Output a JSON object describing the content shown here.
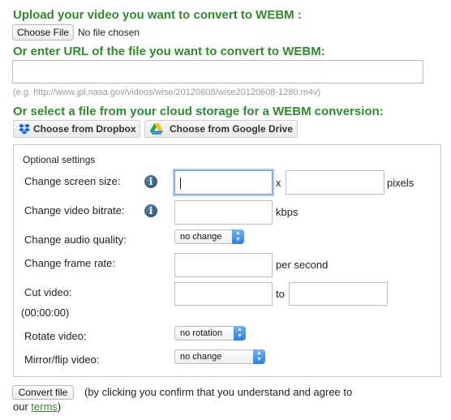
{
  "upload": {
    "heading": "Upload your video you want to convert to WEBM :",
    "choose_file_label": "Choose File",
    "file_status": "No file chosen"
  },
  "url": {
    "heading": "Or enter URL of the file you want to convert to WEBM:",
    "value": "",
    "example": "(e.g. http://www.jpl.nasa.gov/videos/wise/20120608/wise20120608-1280.m4v)"
  },
  "cloud": {
    "heading": "Or select a file from your cloud storage for a WEBM conversion:",
    "dropbox_label": "Choose from Dropbox",
    "gdrive_label": "Choose from Google Drive"
  },
  "settings": {
    "title": "Optional settings",
    "screen_size_label": "Change screen size:",
    "width_value": "",
    "height_value": "",
    "x_separator": "x",
    "pixels_unit": "pixels",
    "bitrate_label": "Change video bitrate:",
    "bitrate_value": "",
    "kbps_unit": "kbps",
    "audio_label": "Change audio quality:",
    "audio_selected": "no change",
    "frame_rate_label": "Change frame rate:",
    "frame_rate_value": "",
    "per_second_unit": "per second",
    "cut_label": "Cut video:",
    "cut_start_value": "",
    "cut_to": "to",
    "cut_end_value": "",
    "cut_format": "(00:00:00)",
    "rotate_label": "Rotate video:",
    "rotate_selected": "no rotation",
    "mirror_label": "Mirror/flip video:",
    "mirror_selected": "no change",
    "info_glyph": "i"
  },
  "convert": {
    "button_label": "Convert file",
    "agreement_prefix": "(by clicking you confirm that you understand and agree to",
    "agreement_our": "our",
    "terms_link": "terms",
    "agreement_suffix": ")"
  },
  "colors": {
    "heading_green": "#2f8a2c",
    "focus_blue": "#6a9fd4",
    "select_arrow_blue": "#2a7ee8",
    "dropbox_blue": "#0061fe"
  },
  "icons": [
    "dropbox-icon",
    "google-drive-icon",
    "info-icon",
    "select-arrows-icon"
  ]
}
